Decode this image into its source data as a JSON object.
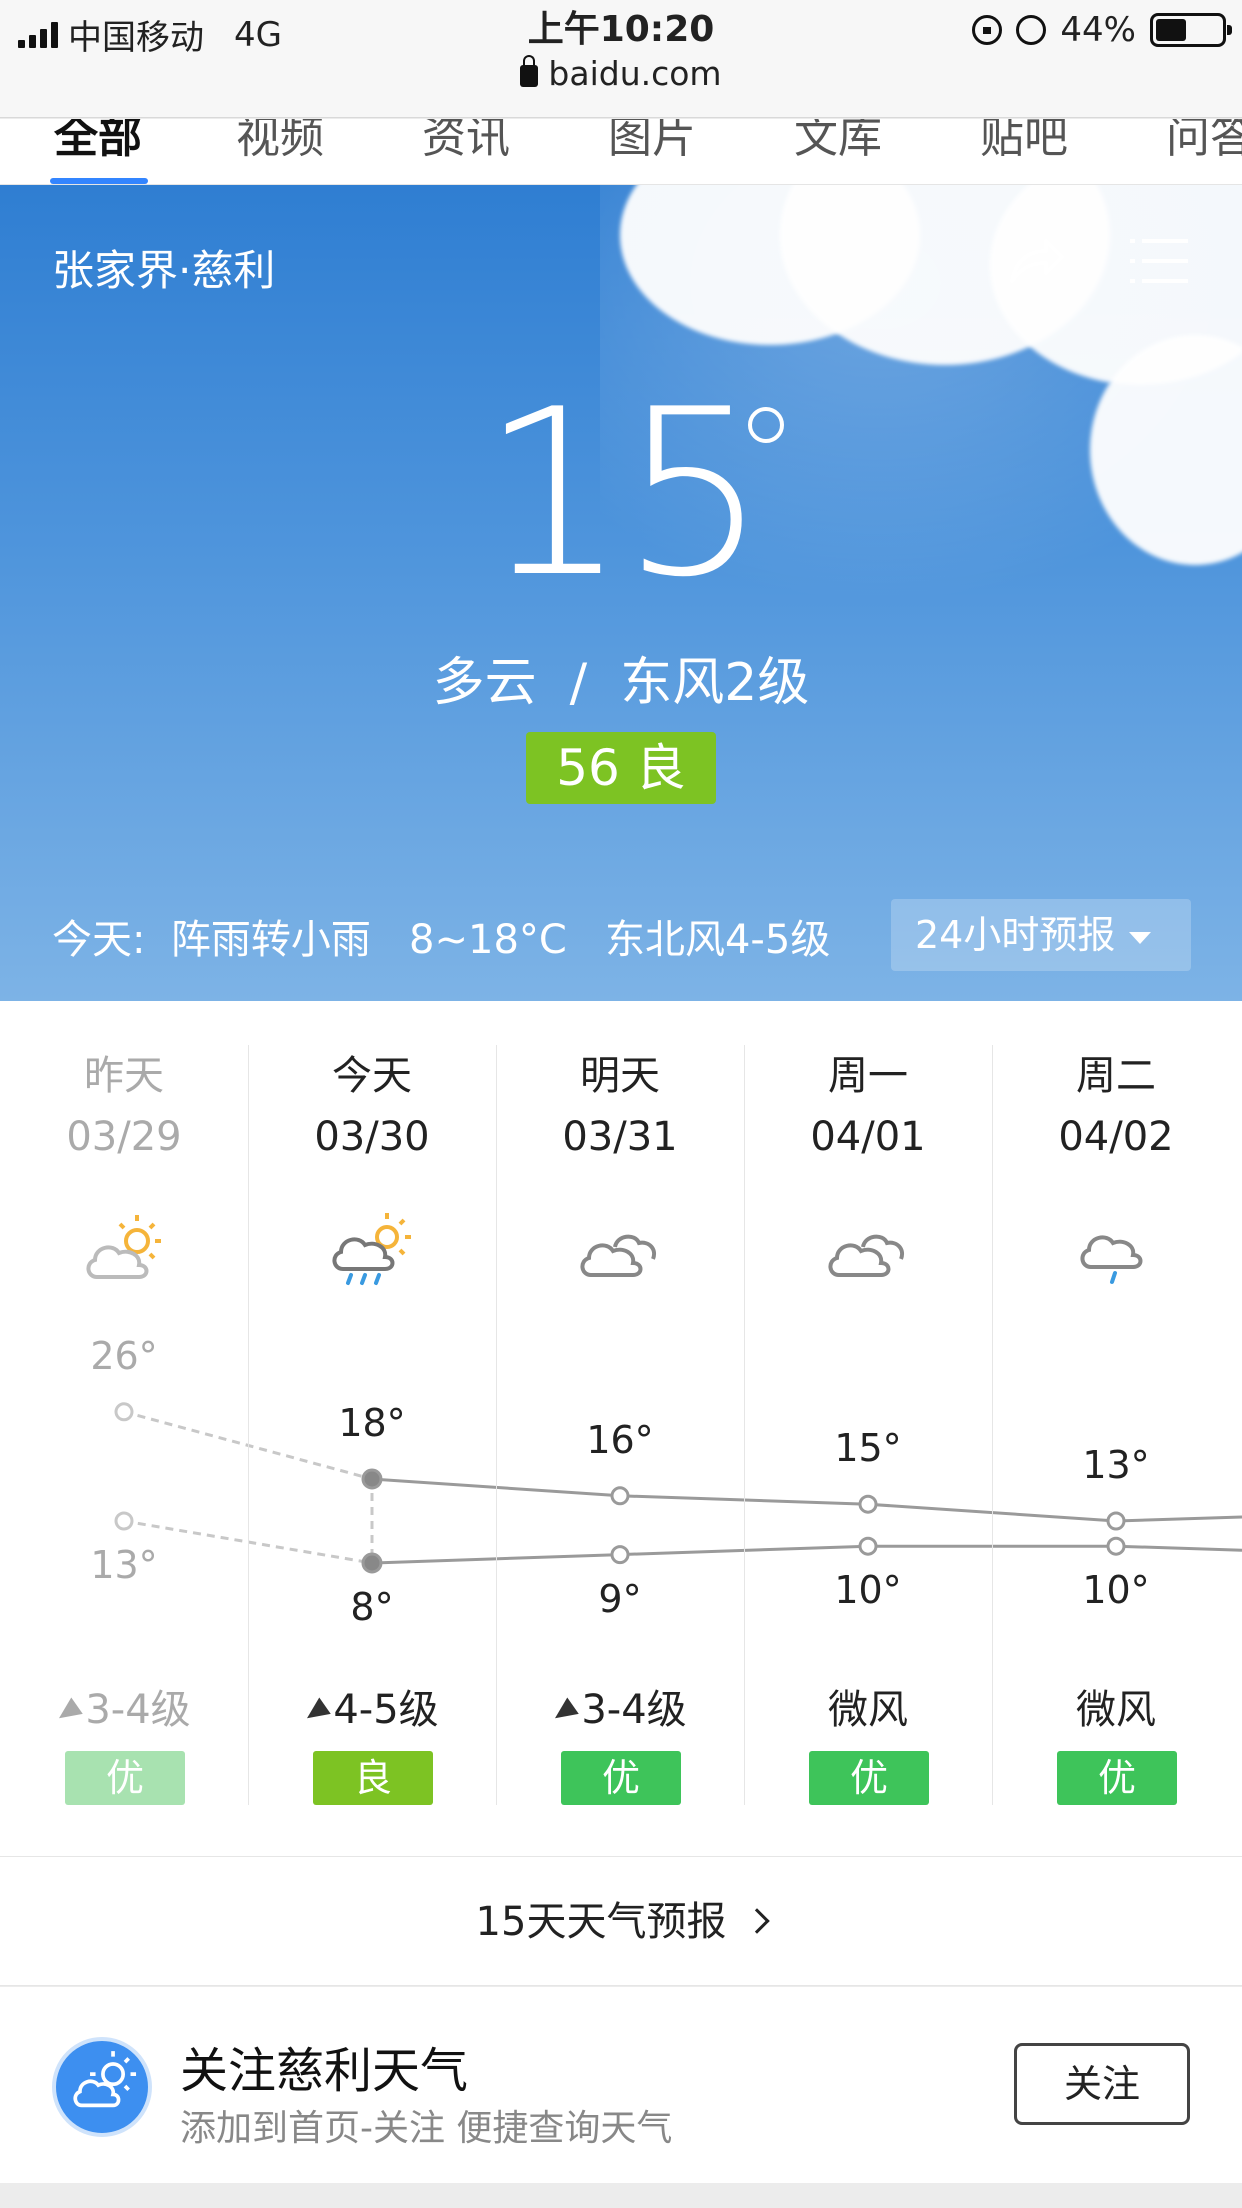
{
  "status_bar": {
    "carrier": "中国移动",
    "network": "4G",
    "time": "上午10:20",
    "url": "baidu.com",
    "battery": "44%"
  },
  "tabs": [
    {
      "label": "全部",
      "active": true
    },
    {
      "label": "视频"
    },
    {
      "label": "资讯"
    },
    {
      "label": "图片"
    },
    {
      "label": "文库"
    },
    {
      "label": "贴吧"
    },
    {
      "label": "问答"
    }
  ],
  "hero": {
    "location": "张家界·慈利",
    "temperature": "15",
    "condition": "多云  /  东风2级",
    "aqi": "56 良",
    "today_summary": "今天:  阵雨转小雨   8~18°C   东北风4-5级",
    "forecast_24h_label": "24小时预报"
  },
  "forecast": {
    "days": [
      {
        "name": "昨天",
        "date": "03/29",
        "icon": "partly-sunny-icon",
        "high": "26°",
        "low": "13°",
        "wind": "3-4级",
        "wind_arrow": true,
        "aq": "优",
        "aq_color": "#a8e2b0",
        "past": true
      },
      {
        "name": "今天",
        "date": "03/30",
        "icon": "rain-sun-icon",
        "high": "18°",
        "low": "8°",
        "wind": "4-5级",
        "wind_arrow": true,
        "aq": "良",
        "aq_color": "#7dc323",
        "past": false
      },
      {
        "name": "明天",
        "date": "03/31",
        "icon": "cloudy-icon",
        "high": "16°",
        "low": "9°",
        "wind": "3-4级",
        "wind_arrow": true,
        "aq": "优",
        "aq_color": "#3ec45a",
        "past": false
      },
      {
        "name": "周一",
        "date": "04/01",
        "icon": "cloudy-icon",
        "high": "15°",
        "low": "10°",
        "wind": "微风",
        "wind_arrow": false,
        "aq": "优",
        "aq_color": "#3ec45a",
        "past": false
      },
      {
        "name": "周二",
        "date": "04/02",
        "icon": "light-rain-icon",
        "high": "13°",
        "low": "10°",
        "wind": "微风",
        "wind_arrow": false,
        "aq": "优",
        "aq_color": "#3ec45a",
        "past": false
      }
    ]
  },
  "chart_data": {
    "type": "line",
    "categories": [
      "03/29",
      "03/30",
      "03/31",
      "04/01",
      "04/02"
    ],
    "series": [
      {
        "values": [
          26,
          18,
          16,
          15,
          13
        ]
      },
      {
        "values": [
          13,
          8,
          9,
          10,
          10
        ]
      }
    ]
  },
  "fifteen_day_link": "15天天气预报",
  "follow": {
    "title": "关注慈利天气",
    "subtitle": "添加到首页-关注 便捷查询天气",
    "button": "关注"
  },
  "colors": {
    "accent": "#3385ff",
    "aq_good": "#3ec45a",
    "aq_moderate": "#7dc323"
  }
}
